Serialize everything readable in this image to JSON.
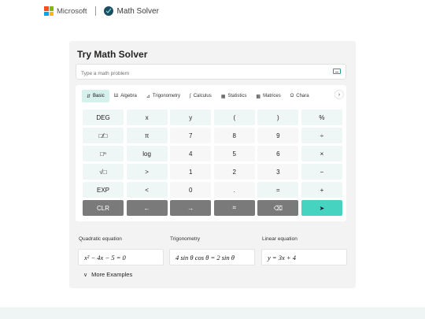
{
  "header": {
    "brand": "Microsoft",
    "product": "Math Solver"
  },
  "panel": {
    "title": "Try Math Solver",
    "input_placeholder": "Type a math problem"
  },
  "tabs": [
    {
      "icon": "⇵",
      "label": "Basic",
      "active": true
    },
    {
      "icon": "Ш",
      "label": "Algebra"
    },
    {
      "icon": "⊿",
      "label": "Trigonometry"
    },
    {
      "icon": "∫",
      "label": "Calculus"
    },
    {
      "icon": "▦",
      "label": "Statistics"
    },
    {
      "icon": "▩",
      "label": "Matrices"
    },
    {
      "icon": "Ω",
      "label": "Chara"
    }
  ],
  "keys": [
    [
      "DEG",
      "x",
      "y",
      "(",
      ")",
      "%"
    ],
    [
      "□⁄□",
      "π",
      "7",
      "8",
      "9",
      "÷"
    ],
    [
      "□ⁿ",
      "log",
      "4",
      "5",
      "6",
      "×"
    ],
    [
      "√□",
      ">",
      "1",
      "2",
      "3",
      "−"
    ],
    [
      "EXP",
      "<",
      "0",
      ".",
      "=",
      "+"
    ],
    [
      "CLR",
      "←",
      "→",
      "⌗",
      "⌫",
      "➤"
    ]
  ],
  "examples": [
    {
      "label": "Quadratic equation",
      "expr": "x² − 4x − 5 = 0"
    },
    {
      "label": "Trigonometry",
      "expr": "4 sin θ cos θ = 2 sin θ"
    },
    {
      "label": "Linear equation",
      "expr": "y = 3x + 4"
    }
  ],
  "more_examples": "More Examples",
  "colors": {
    "accent": "#46d3c0",
    "key_bg": "#eef7f5",
    "dark_key": "#7a7a7a"
  }
}
